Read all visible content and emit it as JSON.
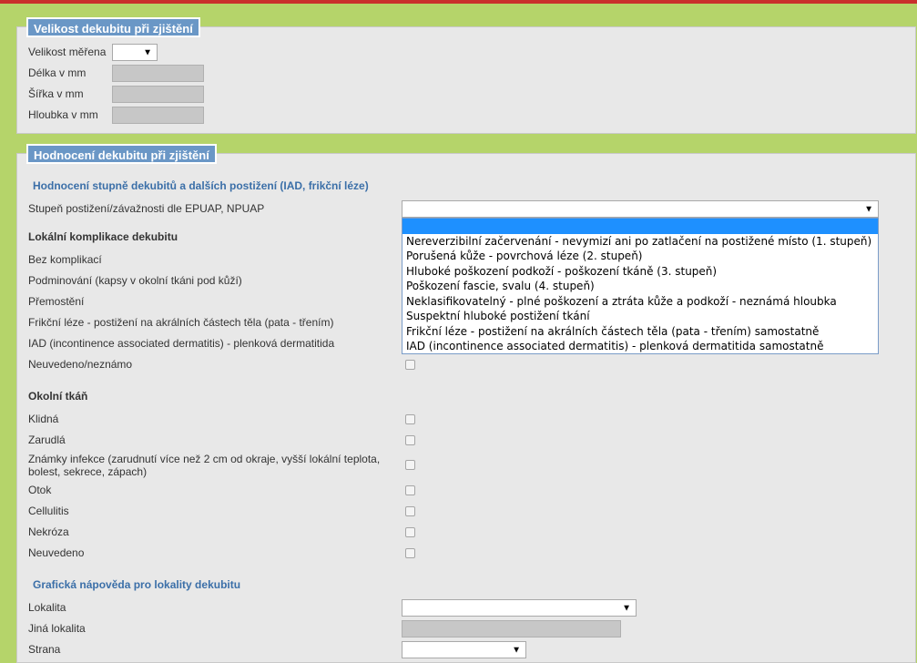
{
  "section1": {
    "title": "Velikost dekubitu při zjištění",
    "measured_label": "Velikost měřena",
    "length_label": "Délka v mm",
    "width_label": "Šířka v mm",
    "depth_label": "Hloubka v mm"
  },
  "section2": {
    "title": "Hodnocení dekubitu při zjištění",
    "subheading": "Hodnocení stupně dekubitů a dalších postižení (IAD, frikční léze)",
    "stage_label": "Stupeň postižení/závažnosti dle EPUAP, NPUAP",
    "stage_options": [
      "",
      "Nereverzibilní začervenání - nevymizí ani po zatlačení na postižené místo (1. stupeň)",
      "Porušená kůže - povrchová léze (2. stupeň)",
      "Hluboké poškození podkoží - poškození tkáně (3. stupeň)",
      "Poškození fascie, svalu (4. stupeň)",
      "Neklasifikovatelný - plné poškození a ztráta kůže a podkoží - neznámá hloubka",
      "Suspektní hluboké postižení tkání",
      "Frikční léze - postižení na akrálních částech těla (pata - třením) samostatně",
      "IAD (incontinence associated dermatitis) - plenková dermatitida samostatně"
    ],
    "local_complications_heading": "Lokální komplikace dekubitu",
    "local_complications": [
      "Bez komplikací",
      "Podminování (kapsy v okolní tkáni pod kůží)",
      "Přemostění",
      "Frikční léze - postižení na akrálních částech těla (pata - třením)",
      "IAD (incontinence associated dermatitis) - plenková dermatitida",
      "Neuvedeno/neznámo"
    ],
    "surrounding_heading": "Okolní tkáň",
    "surrounding": [
      "Klidná",
      "Zarudlá",
      "Známky infekce (zarudnutí více než 2 cm od okraje, vyšší lokální teplota, bolest, sekrece, zápach)",
      "Otok",
      "Cellulitis",
      "Nekróza",
      "Neuvedeno"
    ],
    "graphics_heading": "Grafická nápověda pro lokality dekubitu",
    "locality_label": "Lokalita",
    "other_locality_label": "Jiná lokalita",
    "side_label": "Strana"
  },
  "icons": {
    "dropdown_arrow": "▼"
  },
  "colors": {
    "background": "#b5d46a",
    "panel": "#e8e8e8",
    "legend": "#6a97c6",
    "subheading": "#3b6fa8",
    "option_highlight": "#1e90ff"
  }
}
